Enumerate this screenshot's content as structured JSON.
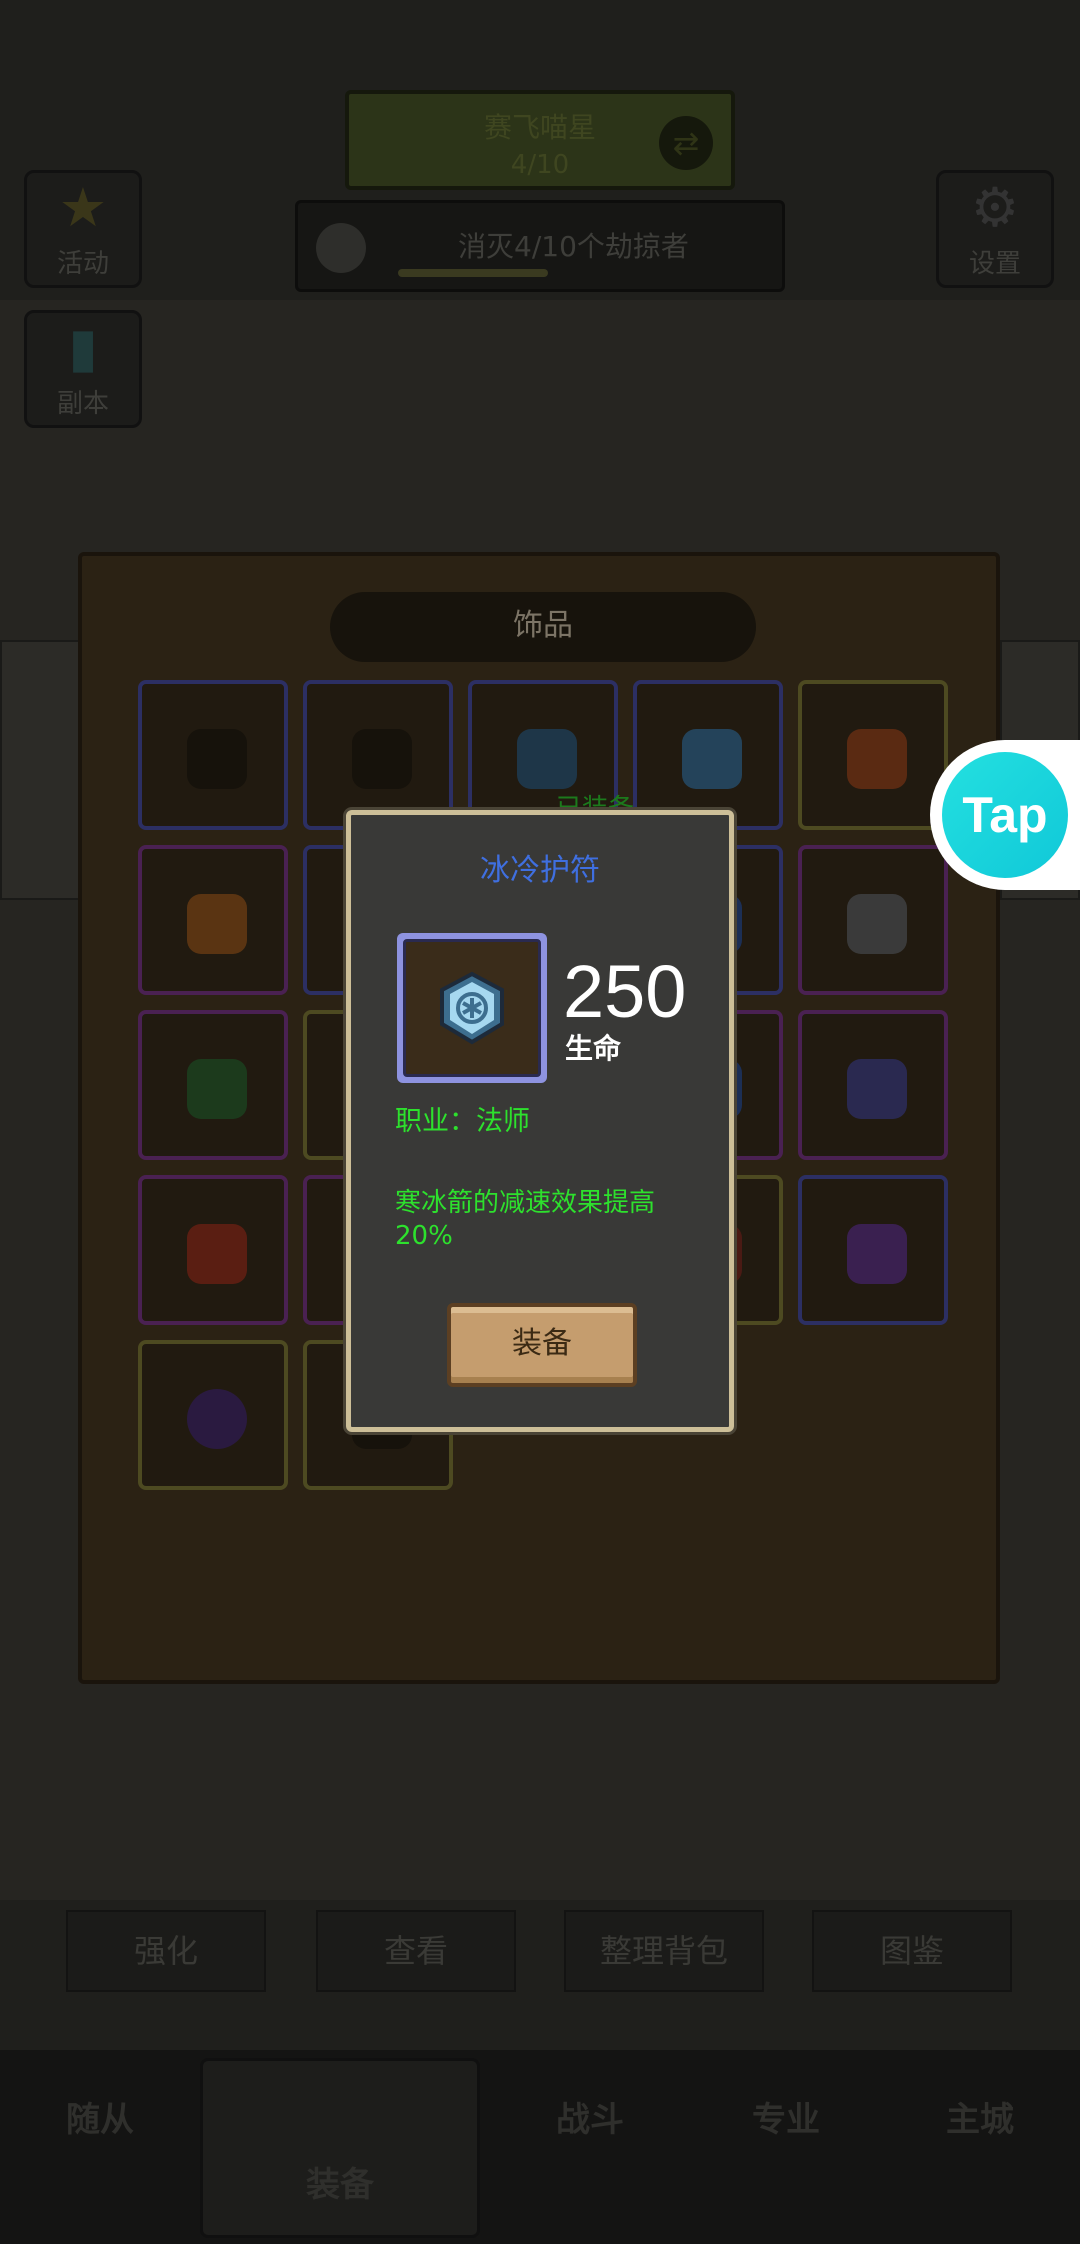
{
  "background": {
    "top_banner": {
      "title": "赛飞喵星",
      "progress": "4/10"
    },
    "quest": {
      "text": "消灭4/10个劫掠者"
    },
    "side_buttons": {
      "activity": "活动",
      "dungeon": "副本",
      "settings": "设置"
    },
    "action_tabs": [
      "强化",
      "查看",
      "整理背包",
      "图鉴"
    ],
    "bottom_nav": [
      "随从",
      "装备",
      "战斗",
      "专业",
      "主城"
    ]
  },
  "panel": {
    "title": "饰品",
    "equipped_tag": "已装备"
  },
  "popup": {
    "item_name": "冰冷护符",
    "stat_value": "250",
    "stat_label": "生命",
    "class_text": "职业：法师",
    "description": "寒冰箭的减速效果提高20%",
    "equip_button": "装备"
  },
  "tap_widget": {
    "label": "Tap"
  },
  "colors": {
    "item_name": "#3f6fe0",
    "green_text": "#2de12d",
    "popup_border": "#cdbf98",
    "tap_accent": "#14d2dc"
  }
}
